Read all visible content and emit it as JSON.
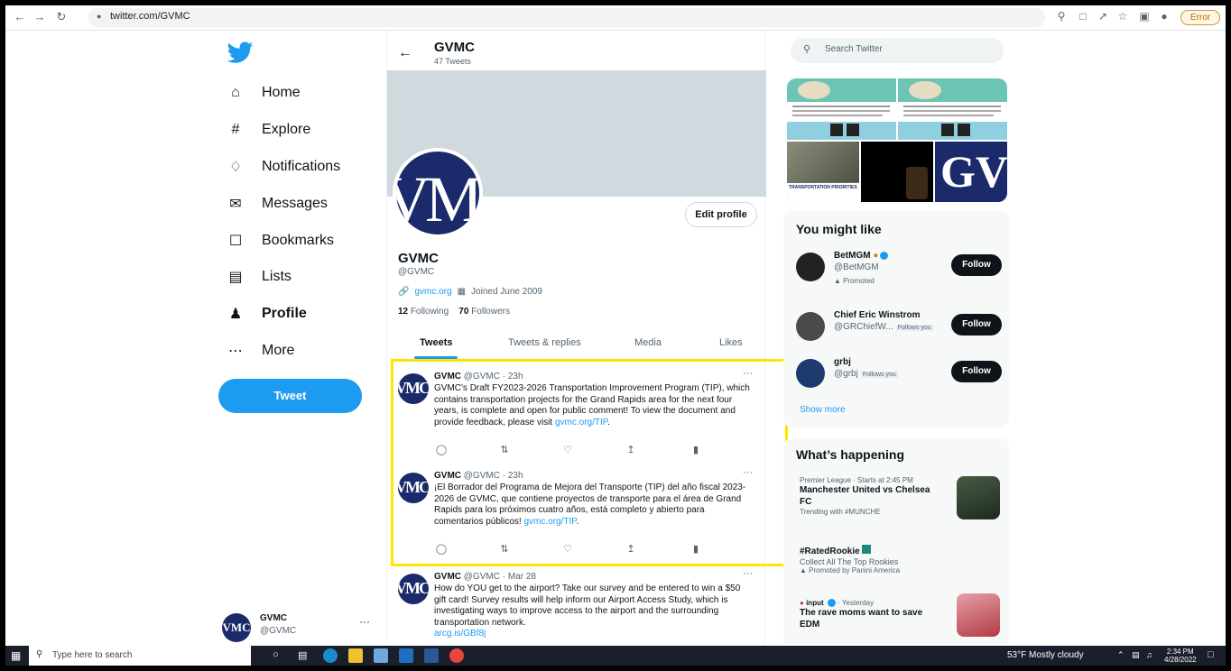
{
  "browser": {
    "url": "twitter.com/GVMC",
    "error_label": "Error"
  },
  "nav": {
    "items": [
      {
        "label": "Home",
        "icon": "home-icon"
      },
      {
        "label": "Explore",
        "icon": "hashtag-icon"
      },
      {
        "label": "Notifications",
        "icon": "bell-icon"
      },
      {
        "label": "Messages",
        "icon": "envelope-icon"
      },
      {
        "label": "Bookmarks",
        "icon": "bookmark-icon"
      },
      {
        "label": "Lists",
        "icon": "list-icon"
      },
      {
        "label": "Profile",
        "icon": "person-icon"
      },
      {
        "label": "More",
        "icon": "more-circle-icon"
      }
    ],
    "tweet_button": "Tweet",
    "account_name": "GVMC",
    "account_handle": "@GVMC",
    "account_avatar": "VMC"
  },
  "header": {
    "name": "GVMC",
    "tweet_count": "47 Tweets"
  },
  "profile": {
    "avatar_text": "VM",
    "edit_button": "Edit profile",
    "name": "GVMC",
    "handle": "@GVMC",
    "website": "gvmc.org",
    "joined": "Joined June 2009",
    "following_count": "12",
    "following_label": "Following",
    "followers_count": "70",
    "followers_label": "Followers"
  },
  "tabs": [
    "Tweets",
    "Tweets & replies",
    "Media",
    "Likes"
  ],
  "tweets": [
    {
      "avatar": "VMC",
      "name": "GVMC",
      "meta": "@GVMC · 23h",
      "text": "GVMC's Draft FY2023-2026 Transportation Improvement Program (TIP), which contains transportation projects for the Grand Rapids area for the next four years, is complete and open for public comment! To view the document and provide feedback, please visit ",
      "link": "gvmc.org/TIP",
      "after": "."
    },
    {
      "avatar": "VMC",
      "name": "GVMC",
      "meta": "@GVMC · 23h",
      "text": "¡El Borrador del Programa de Mejora del Transporte (TIP) del año fiscal 2023-2026 de GVMC, que contiene proyectos de transporte para el área de Grand Rapids para los próximos cuatro años, está completo y abierto para comentarios públicos! ",
      "link": "gvmc.org/TIP",
      "after": "."
    },
    {
      "avatar": "VMC",
      "name": "GVMC",
      "meta": "@GVMC · Mar 28",
      "text": "How do YOU get to the airport? Take our survey and be entered to win a $50 gift card! Survey results will help inform our Airport Access Study, which is investigating ways to improve access to the airport and the surrounding transportation network.",
      "link": "arcg.is/GBf8j",
      "after": ""
    }
  ],
  "dots": "···",
  "search": {
    "placeholder": "Search Twitter"
  },
  "media_tiles": {
    "transport_priorities": "TRANSPORTATION PRIORITIES",
    "brand_letters": "GV"
  },
  "might_like": {
    "title": "You might like",
    "suggestions": [
      {
        "name": "BetMGM",
        "handle": "@BetMGM",
        "follows_you": "",
        "promoted": "Promoted",
        "button": "Follow"
      },
      {
        "name": "Chief Eric Winstrom",
        "handle": "@GRChiefW...",
        "follows_you": "Follows you",
        "promoted": "",
        "button": "Follow"
      },
      {
        "name": "grbj",
        "handle": "@grbj",
        "follows_you": "Follows you",
        "promoted": "",
        "button": "Follow"
      }
    ],
    "show_more": "Show more"
  },
  "happening": {
    "title": "What’s happening",
    "trends": [
      {
        "meta": "Premier League · Starts at 2:45 PM",
        "title": "Manchester United vs Chelsea FC",
        "sub": "Trending with #MUNCHE"
      },
      {
        "meta": "",
        "title": "#RatedRookie",
        "sub": "Collect All The Top Rookies",
        "promoted": "Promoted by Panini America"
      },
      {
        "meta_source": "input",
        "meta": " · Yesterday",
        "title": "The rave moms want to save EDM",
        "sub": ""
      }
    ]
  },
  "taskbar": {
    "search_placeholder": "Type here to search",
    "weather": "53°F  Mostly cloudy",
    "time": "2:34 PM",
    "date": "4/28/2022"
  },
  "colors": {
    "twitter_blue": "#1d9bf0",
    "highlight": "#ffe600",
    "gvmc_navy": "#1b2a6b"
  }
}
